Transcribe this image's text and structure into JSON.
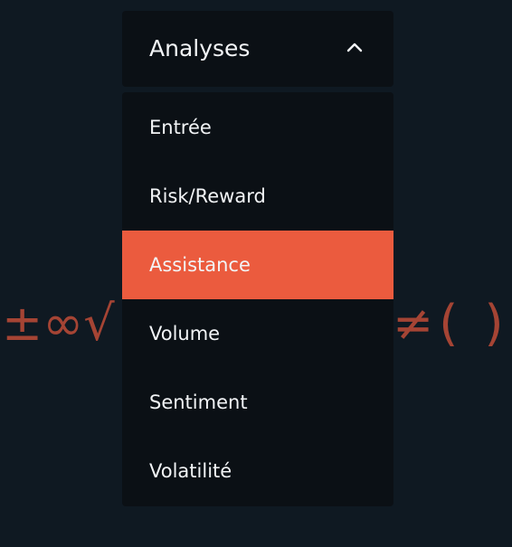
{
  "background": {
    "math_left": "±∞√",
    "math_right": "≠( )",
    "color": "#a54434"
  },
  "dropdown": {
    "title": "Analyses",
    "chevron_icon": "chevron-up-icon",
    "selected": "Assistance",
    "accent_color": "#eb5b3e",
    "items": [
      {
        "label": "Entrée"
      },
      {
        "label": "Risk/Reward"
      },
      {
        "label": "Assistance"
      },
      {
        "label": "Volume"
      },
      {
        "label": "Sentiment"
      },
      {
        "label": "Volatilité"
      }
    ]
  }
}
